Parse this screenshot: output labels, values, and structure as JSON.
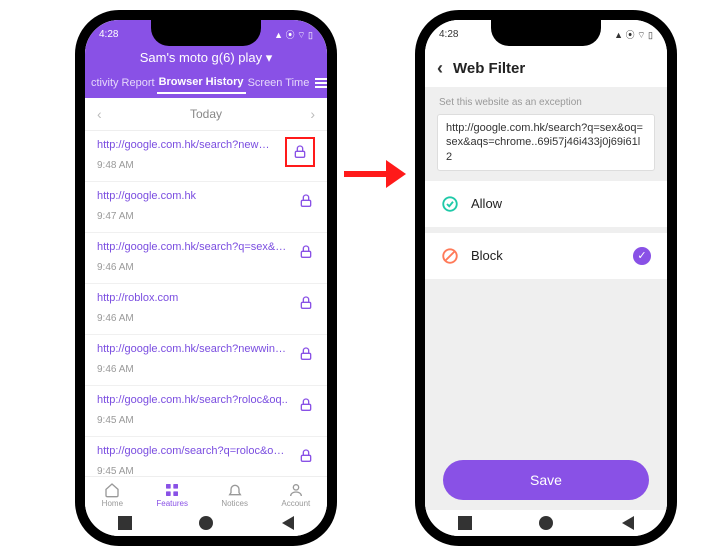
{
  "left": {
    "status_time": "4:28",
    "device_name": "Sam's moto g(6) play ▾",
    "tabs": [
      "ctivity Report",
      "Browser History",
      "Screen Time"
    ],
    "active_tab": 1,
    "day_label": "Today",
    "history": [
      {
        "url": "http://google.com.hk/search?newwindow..",
        "time": "9:48 AM",
        "highlight": true
      },
      {
        "url": "http://google.com.hk",
        "time": "9:47 AM",
        "highlight": false
      },
      {
        "url": "http://google.com.hk/search?q=sex&oq=s..",
        "time": "9:46 AM",
        "highlight": false
      },
      {
        "url": "http://roblox.com",
        "time": "9:46 AM",
        "highlight": false
      },
      {
        "url": "http://google.com.hk/search?newwindow..",
        "time": "9:46 AM",
        "highlight": false
      },
      {
        "url": "http://google.com.hk/search?roloc&oq..",
        "time": "9:45 AM",
        "highlight": false
      },
      {
        "url": "http://google.com/search?q=roloc&oq=rol..",
        "time": "9:45 AM",
        "highlight": false
      }
    ],
    "nav": [
      {
        "label": "Home",
        "active": false
      },
      {
        "label": "Features",
        "active": true
      },
      {
        "label": "Notices",
        "active": false
      },
      {
        "label": "Account",
        "active": false
      }
    ]
  },
  "right": {
    "status_time": "4:28",
    "title": "Web Filter",
    "subtitle": "Set this website as an exception",
    "url_value": "http://google.com.hk/search?q=sex&oq=sex&aqs=chrome..69i57j46i433j0j69i61l2",
    "option_allow": "Allow",
    "option_block": "Block",
    "save_label": "Save"
  }
}
